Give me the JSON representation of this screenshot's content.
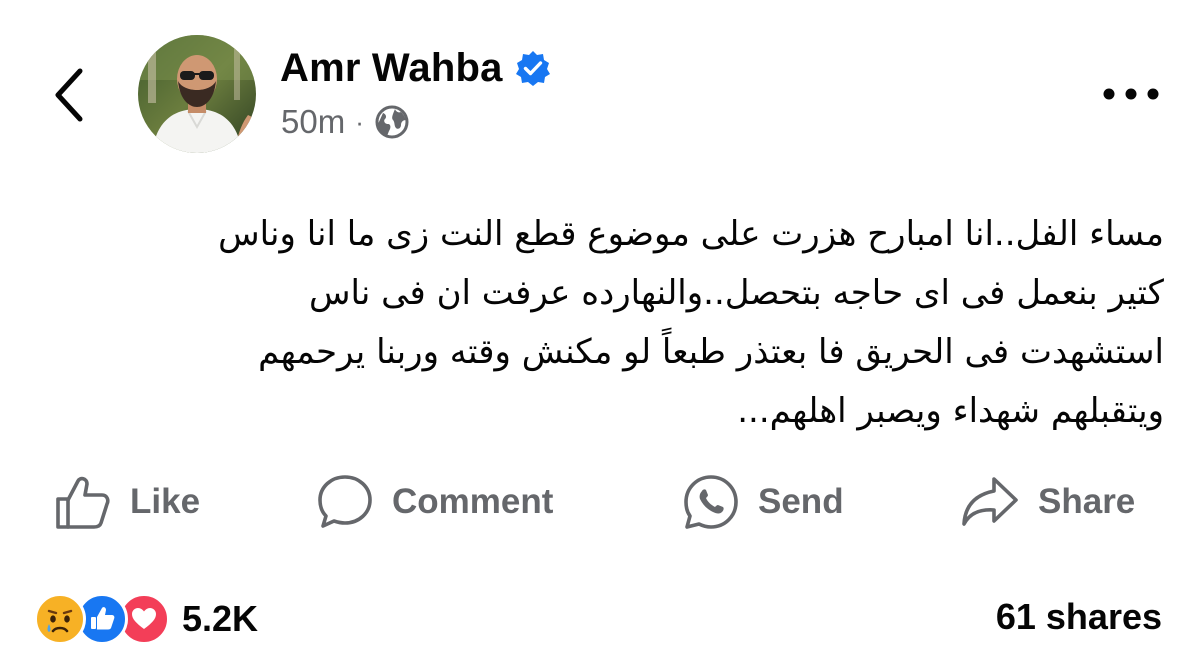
{
  "header": {
    "author_name": "Amr Wahba",
    "verified": true,
    "timestamp": "50m",
    "separator": "·",
    "audience_icon": "globe-icon",
    "back_icon": "chevron-left-icon",
    "more_icon": "more-horizontal-icon"
  },
  "post": {
    "text_lines": [
      "مساء الفل..انا امبارح هزرت على موضوع قطع النت زى ما انا وناس",
      "كتير بنعمل فى اى حاجه بتحصل..والنهارده عرفت ان فى ناس",
      "استشهدت فى الحريق فا بعتذر طبعاً لو مكنش وقته وربنا يرحمهم",
      "ويتقبلهم شهداء ويصبر اهلهم..."
    ]
  },
  "actions": [
    {
      "label": "Like",
      "icon": "thumbs-up-icon"
    },
    {
      "label": "Comment",
      "icon": "comment-bubble-icon"
    },
    {
      "label": "Send",
      "icon": "whatsapp-icon"
    },
    {
      "label": "Share",
      "icon": "share-arrow-icon"
    }
  ],
  "footer": {
    "reactions": [
      "sad-reaction-icon",
      "like-reaction-icon",
      "love-reaction-icon"
    ],
    "reaction_count": "5.2K",
    "shares_count": "61 shares"
  },
  "colors": {
    "text": "#050505",
    "secondary": "#65676b",
    "verified_blue": "#1877f2",
    "love_red": "#f33e58",
    "sad_yellow": "#f7b125"
  }
}
